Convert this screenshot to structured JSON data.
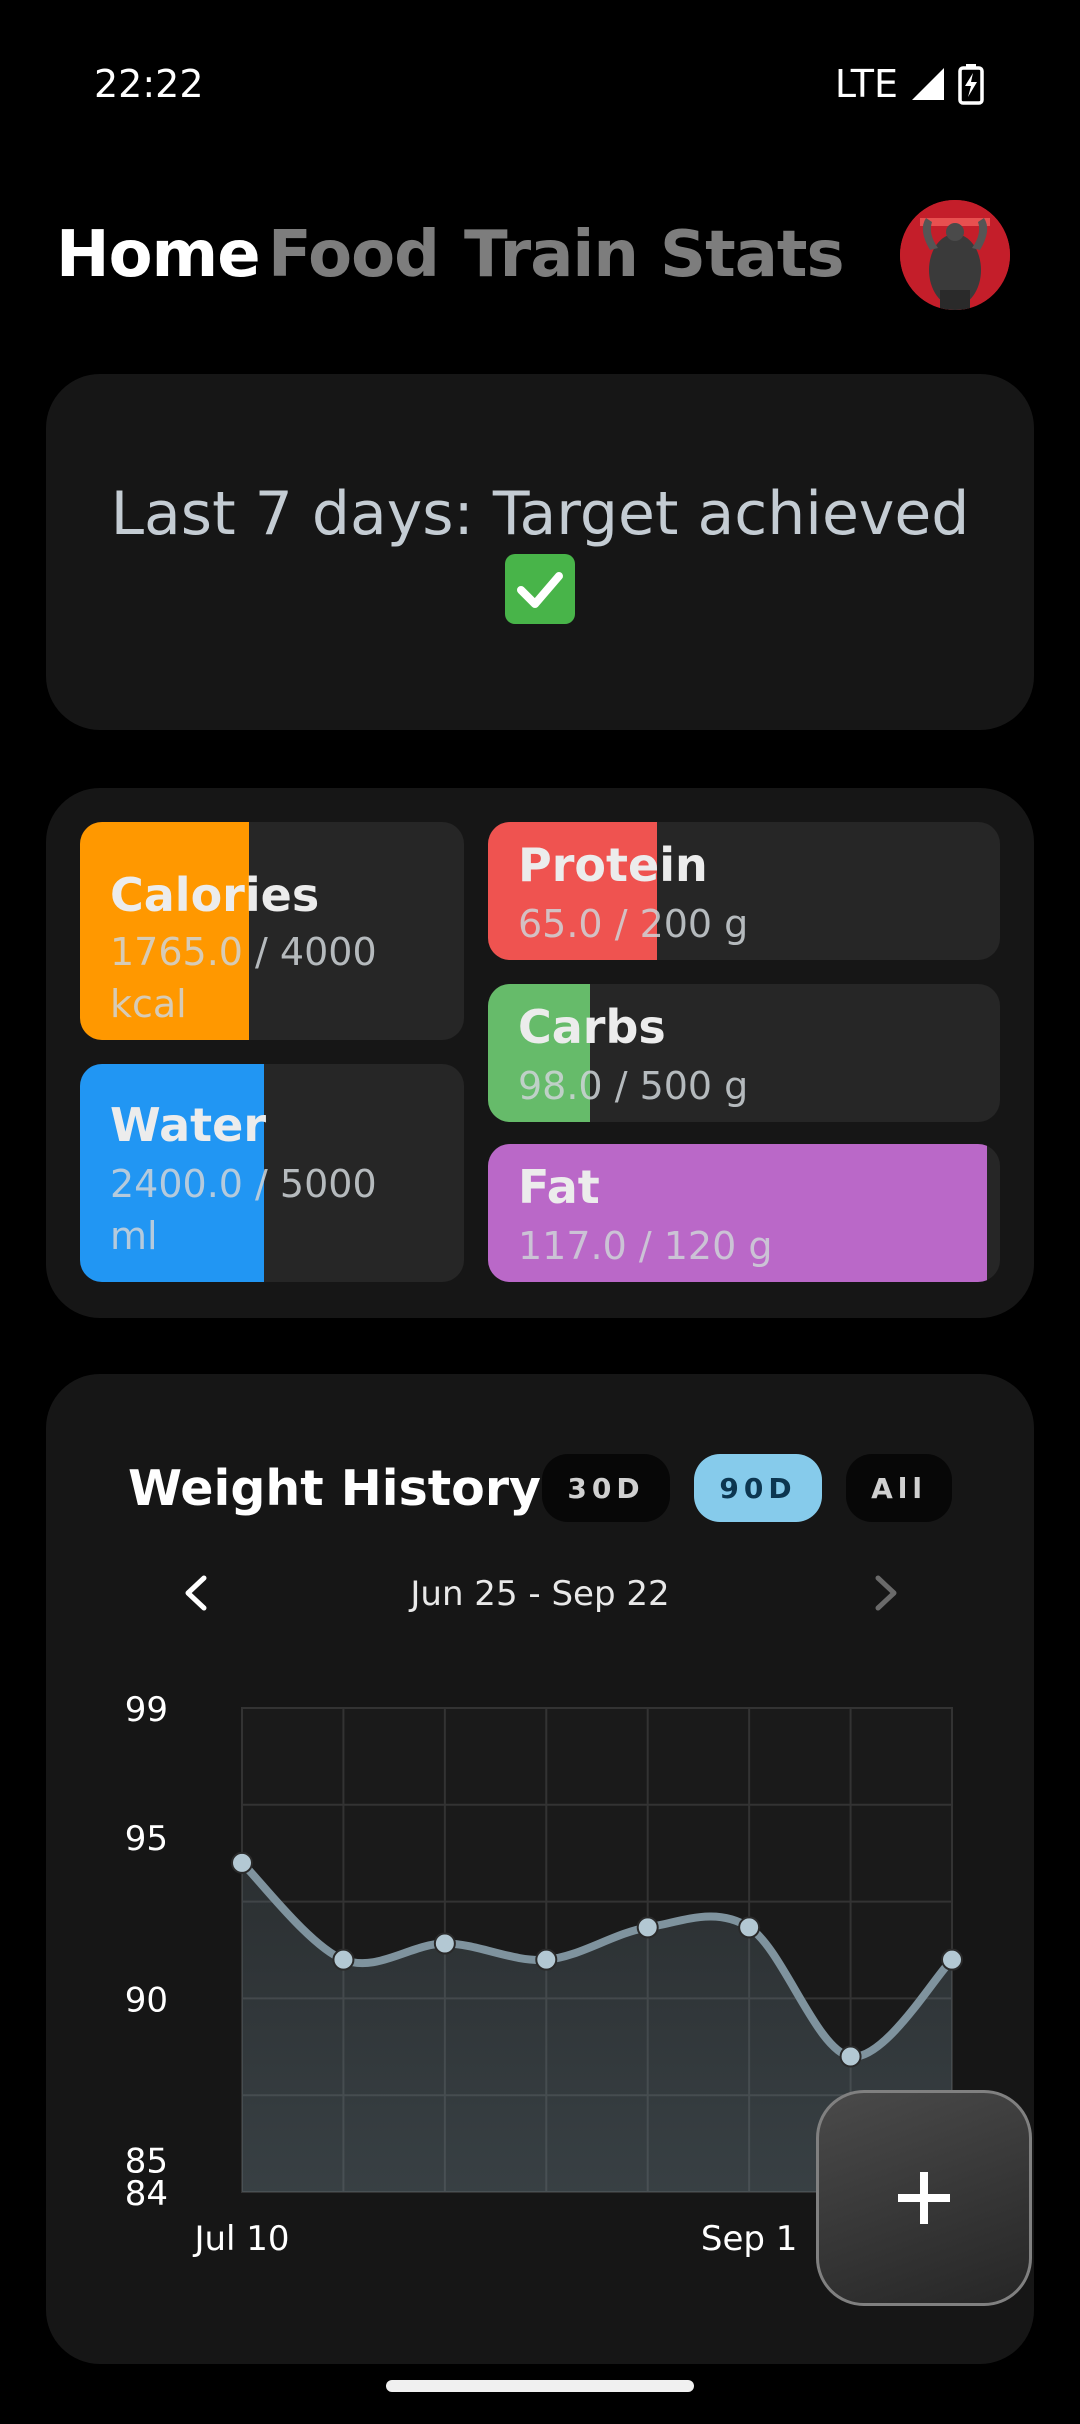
{
  "status": {
    "time": "22:22",
    "network": "LTE"
  },
  "nav": {
    "tabs": [
      "Home",
      "Food",
      "Train",
      "Stats"
    ],
    "active": "Home"
  },
  "banner": {
    "text": "Last 7 days: Target achieved",
    "icon": "check-mark-emoji"
  },
  "macros": {
    "calories": {
      "title": "Calories",
      "value_line1": "1765.0 / 4000",
      "value_line2": "kcal",
      "progress": 0.44,
      "color": "#ff9800"
    },
    "water": {
      "title": "Water",
      "value_line1": "2400.0 / 5000",
      "value_line2": "ml",
      "progress": 0.48,
      "color": "#2196f3"
    },
    "protein": {
      "title": "Protein",
      "value": "65.0 / 200 g",
      "progress": 0.33,
      "color": "#ef5350"
    },
    "carbs": {
      "title": "Carbs",
      "value": "98.0 / 500 g",
      "progress": 0.2,
      "color": "#66bb6a"
    },
    "fat": {
      "title": "Fat",
      "value": "117.0 / 120 g",
      "progress": 0.975,
      "color": "#ba68c8"
    }
  },
  "weight_history": {
    "title": "Weight History",
    "ranges": [
      "30D",
      "90D",
      "All"
    ],
    "active_range": "90D",
    "date_range": "Jun 25 - Sep 22",
    "accent": "#86cbeb"
  },
  "chart_data": {
    "type": "line",
    "title": "Weight History",
    "x_labels": [
      "Jul 10",
      "Sep 1"
    ],
    "y_ticks": [
      "99",
      "95",
      "90",
      "85",
      "84"
    ],
    "ylim": [
      84,
      99
    ],
    "values": [
      94.2,
      91.2,
      91.7,
      91.2,
      92.2,
      92.2,
      88.2,
      91.2
    ],
    "grid": true
  }
}
